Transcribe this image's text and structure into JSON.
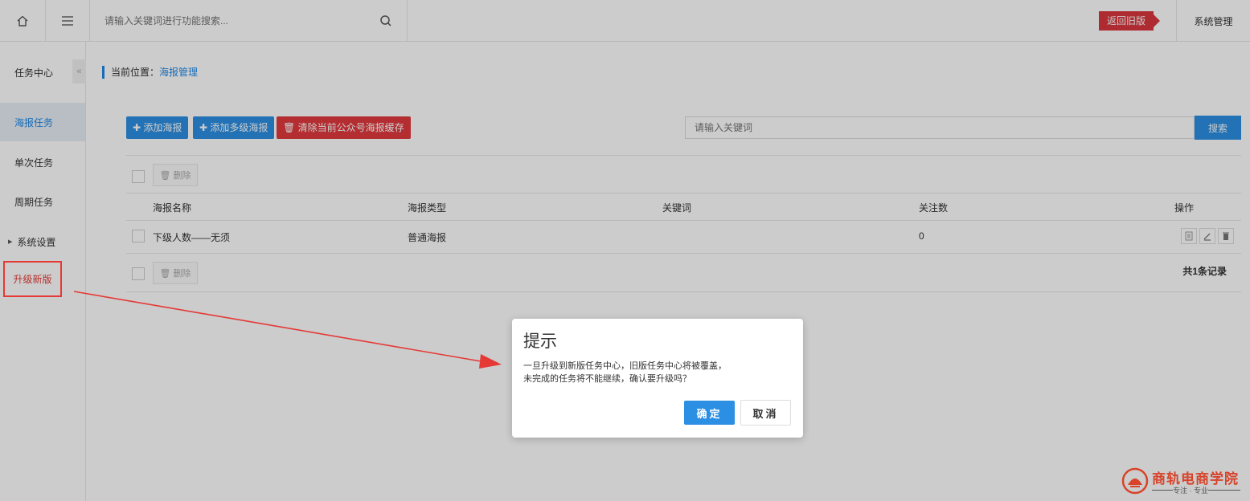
{
  "topbar": {
    "search_placeholder": "请输入关键词进行功能搜索...",
    "back_old_label": "返回旧版",
    "system_label": "系统管理"
  },
  "sidebar": {
    "title": "任务中心",
    "collapse": "«",
    "items": [
      {
        "label": "海报任务"
      },
      {
        "label": "单次任务"
      },
      {
        "label": "周期任务"
      },
      {
        "label": "系统设置"
      }
    ],
    "upgrade_label": "升级新版"
  },
  "breadcrumb": {
    "prefix": "当前位置：",
    "current": "海报管理"
  },
  "toolbar": {
    "add_poster": "✚ 添加海报",
    "add_multi_poster": "✚ 添加多级海报",
    "clear_cache": "🗑 清除当前公众号海报缓存",
    "keyword_placeholder": "请输入关键词",
    "search_label": "搜索"
  },
  "table": {
    "delete_label": "删除",
    "headers": [
      "海报名称",
      "海报类型",
      "关键词",
      "关注数",
      "操作"
    ],
    "rows": [
      {
        "name": "下级人数——无须",
        "type": "普通海报",
        "keyword": "",
        "followers": "0"
      }
    ],
    "total": "共1条记录"
  },
  "dialog": {
    "title": "提示",
    "line1": "一旦升级到新版任务中心，旧版任务中心将被覆盖，",
    "line2": "未完成的任务将不能继续，确认要升级吗？",
    "ok_label": "确定",
    "cancel_label": "取消"
  },
  "logo": {
    "text": "商轨电商学院",
    "sub": "专注 · 专业"
  },
  "colors": {
    "accent": "#2b8fe3",
    "danger": "#e0393e",
    "annotation": "#e53935"
  }
}
